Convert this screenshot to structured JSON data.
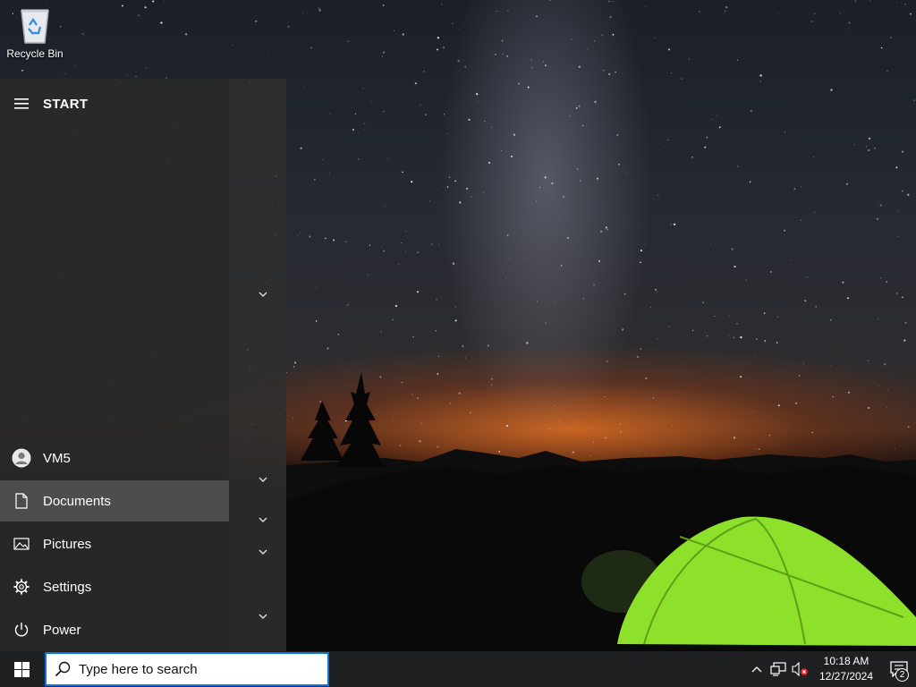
{
  "desktop": {
    "icons": [
      {
        "label": "Recycle Bin",
        "icon": "recycle-bin-icon"
      }
    ]
  },
  "start_menu": {
    "title": "START",
    "menu_icon": "hamburger-menu-icon",
    "items": [
      {
        "label": "VM5",
        "icon": "user-avatar-icon"
      },
      {
        "label": "Documents",
        "icon": "document-icon",
        "active": true
      },
      {
        "label": "Pictures",
        "icon": "pictures-icon"
      },
      {
        "label": "Settings",
        "icon": "gear-icon"
      },
      {
        "label": "Power",
        "icon": "power-icon"
      }
    ]
  },
  "taskbar": {
    "start_icon": "windows-logo-icon",
    "search": {
      "placeholder": "Type here to search",
      "icon": "search-icon"
    },
    "tray": {
      "icons": [
        "chevron-up-icon",
        "network-icon",
        "volume-muted-icon"
      ],
      "time": "10:18 AM",
      "date": "12/27/2024",
      "notification_count": "2"
    }
  },
  "colors": {
    "accent": "#0a74d8",
    "taskbar": "#1f2022",
    "tent": "#8ee12a"
  }
}
